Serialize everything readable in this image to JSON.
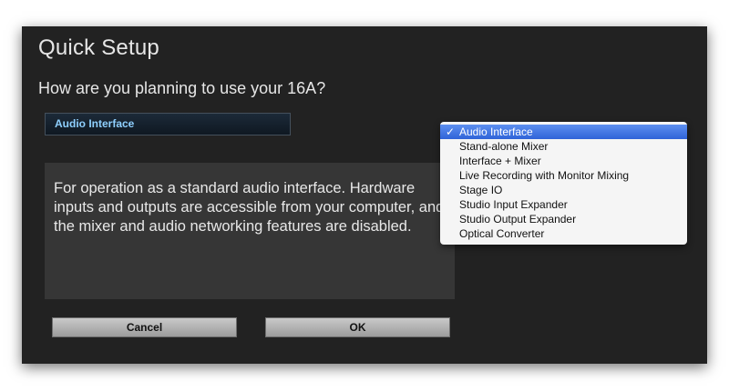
{
  "dialog": {
    "title": "Quick Setup",
    "question": "How are you planning to use your 16A?",
    "selected_mode": "Audio Interface",
    "description": "For operation as a standard audio interface. Hardware inputs and outputs are accessible from your computer, and the mixer and audio networking features are disabled.",
    "cancel_label": "Cancel",
    "ok_label": "OK"
  },
  "dropdown": {
    "check_glyph": "✓",
    "items": [
      {
        "label": "Audio Interface",
        "selected": true
      },
      {
        "label": "Stand-alone Mixer",
        "selected": false
      },
      {
        "label": "Interface + Mixer",
        "selected": false
      },
      {
        "label": "Live Recording with Monitor Mixing",
        "selected": false
      },
      {
        "label": "Stage IO",
        "selected": false
      },
      {
        "label": "Studio Input Expander",
        "selected": false
      },
      {
        "label": "Studio Output Expander",
        "selected": false
      },
      {
        "label": "Optical Converter",
        "selected": false
      }
    ]
  },
  "colors": {
    "dialog_bg": "#222222",
    "panel_bg": "#363636",
    "selection_accent": "#3a6fe0",
    "select_text": "#8fd0ff"
  }
}
